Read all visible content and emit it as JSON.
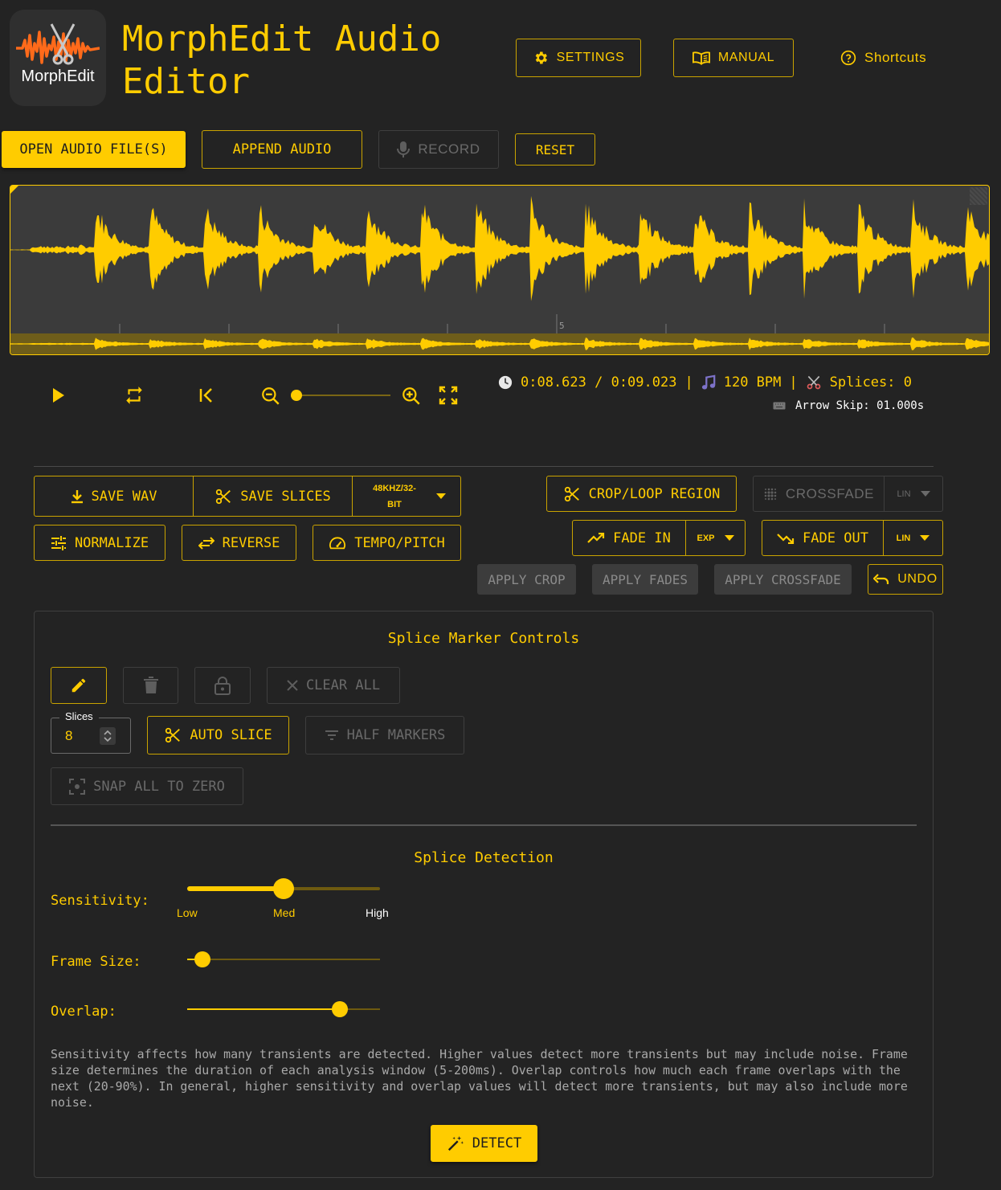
{
  "header": {
    "logo_text": "MorphEdit",
    "title_line1": "MorphEdit Audio",
    "title_line2": "Editor",
    "settings_label": "SETTINGS",
    "manual_label": "MANUAL",
    "shortcuts_label": "Shortcuts"
  },
  "file_bar": {
    "open_label": "OPEN AUDIO FILE(S)",
    "append_label": "APPEND AUDIO",
    "record_label": "RECORD",
    "reset_label": "RESET"
  },
  "waveform": {
    "color": "#ffcc00",
    "beat_marker": "5"
  },
  "transport": {
    "time_readout": "0:08.623 / 0:09.023",
    "divider": "|",
    "bpm": "120 BPM",
    "splices": "Splices: 0",
    "arrow_skip": "Arrow Skip: 01.000s",
    "zoom_level": 0
  },
  "actions": {
    "save_wav": "SAVE WAV",
    "save_slices": "SAVE SLICES",
    "format_line1": "48KHZ/32-",
    "format_line2": "BIT",
    "normalize": "NORMALIZE",
    "reverse": "REVERSE",
    "tempo_pitch": "TEMPO/PITCH",
    "crop_loop": "CROP/LOOP REGION",
    "crossfade": "CROSSFADE",
    "crossfade_curve": "LIN",
    "fade_in": "FADE IN",
    "fade_in_curve": "EXP",
    "fade_out": "FADE OUT",
    "fade_out_curve": "LIN",
    "apply_crop": "APPLY CROP",
    "apply_fades": "APPLY FADES",
    "apply_crossfade": "APPLY CROSSFADE",
    "undo": "UNDO"
  },
  "splice_markers": {
    "title": "Splice Marker Controls",
    "clear_all": "CLEAR ALL",
    "slices_label": "Slices",
    "slices_value": "8",
    "auto_slice": "AUTO SLICE",
    "half_markers": "HALF MARKERS",
    "snap_all": "SNAP ALL TO ZERO"
  },
  "splice_detection": {
    "title": "Splice Detection",
    "sensitivity_label": "Sensitivity:",
    "sensitivity_low": "Low",
    "sensitivity_med": "Med",
    "sensitivity_high": "High",
    "sensitivity_value": 0.5,
    "frame_label": "Frame Size:",
    "frame_value": 0.08,
    "overlap_label": "Overlap:",
    "overlap_value": 0.79,
    "help_text": "Sensitivity affects how many transients are detected. Higher values detect more transients but may include noise. Frame size determines the duration of each analysis window (5-200ms). Overlap controls how much each frame overlaps with the next (20-90%). In general, higher sensitivity and overlap values will detect more transients, but may also include more noise.",
    "detect_label": "DETECT"
  }
}
